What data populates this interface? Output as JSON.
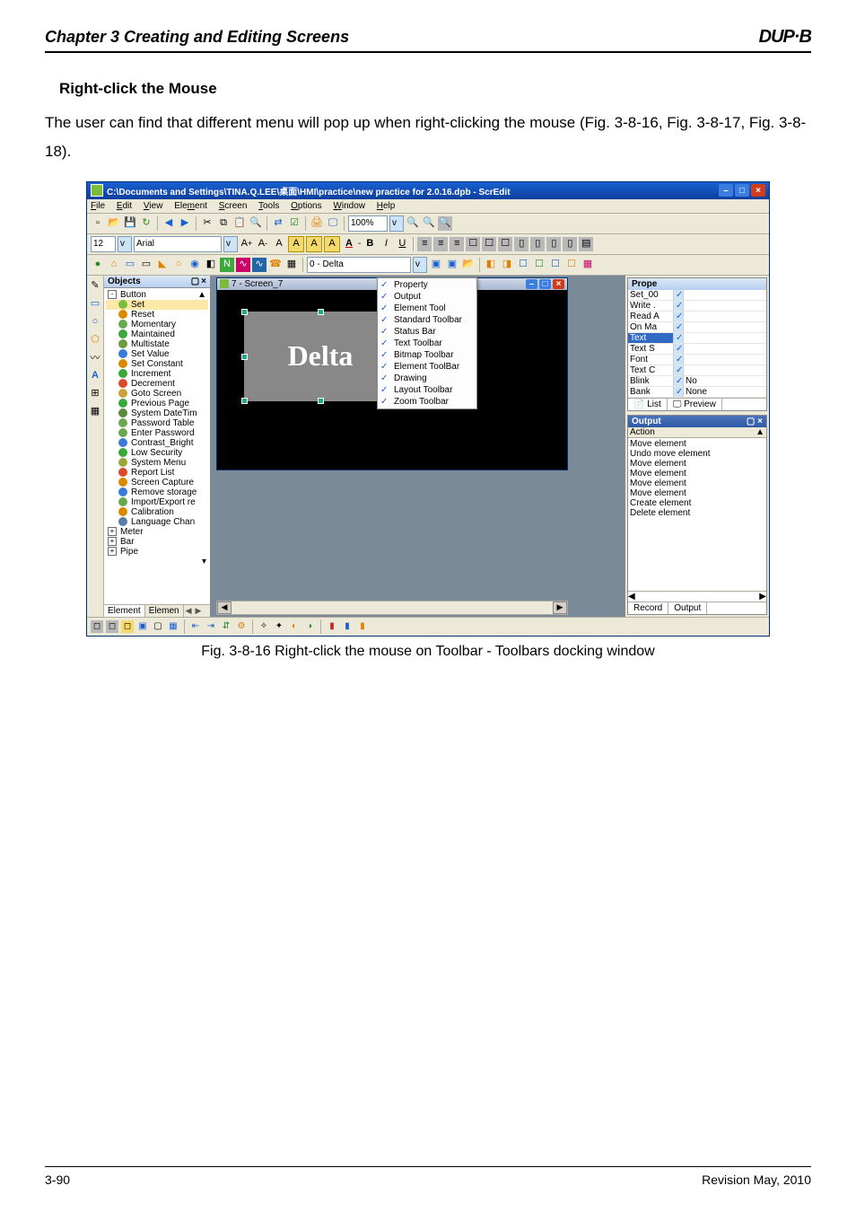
{
  "page": {
    "chapter_title": "Chapter 3 Creating and Editing Screens",
    "logo": "DUP·B",
    "section_title": "Right-click the Mouse",
    "body_text": "The user can find that different menu will pop up when right-clicking the mouse (Fig. 3-8-16, Fig. 3-8-17, Fig. 3-8-18).",
    "figure_caption": "Fig. 3-8-16 Right-click the mouse on Toolbar - Toolbars docking window",
    "footer_left": "3-90",
    "footer_right": "Revision May, 2010"
  },
  "window": {
    "title": "C:\\Documents and Settings\\TINA.Q.LEE\\桌面\\HMI\\practice\\new practice for 2.0.16.dpb - ScrEdit",
    "menus": [
      "File",
      "Edit",
      "View",
      "Element",
      "Screen",
      "Tools",
      "Options",
      "Window",
      "Help"
    ],
    "font_size": "12",
    "font_name": "Arial",
    "zoom_value": "100%",
    "screen_selector": "0 - Delta",
    "child_window_title": "7 - Screen_7",
    "canvas_text": "Delta"
  },
  "zoom_icons": [
    "🔍",
    "🔍",
    "🔍"
  ],
  "objects_panel": {
    "title": "Objects",
    "root": "Button",
    "items": [
      {
        "label": "Set",
        "color": "#7bbd3a",
        "sel": true
      },
      {
        "label": "Reset",
        "color": "#d98a00"
      },
      {
        "label": "Momentary",
        "color": "#6aa84f"
      },
      {
        "label": "Maintained",
        "color": "#3aa83a"
      },
      {
        "label": "Multistate",
        "color": "#6b9b3a"
      },
      {
        "label": "Set Value",
        "color": "#3a7ad9"
      },
      {
        "label": "Set Constant",
        "color": "#d98a00"
      },
      {
        "label": "Increment",
        "color": "#3aa83a"
      },
      {
        "label": "Decrement",
        "color": "#d94a2a"
      },
      {
        "label": "Goto Screen",
        "color": "#c9a23a"
      },
      {
        "label": "Previous Page",
        "color": "#3aa83a"
      },
      {
        "label": "System DateTim",
        "color": "#5a8a3a"
      },
      {
        "label": "Password Table",
        "color": "#6aa84f"
      },
      {
        "label": "Enter Password",
        "color": "#6aa84f"
      },
      {
        "label": "Contrast_Bright",
        "color": "#3a7ad9"
      },
      {
        "label": "Low Security",
        "color": "#3aa83a"
      },
      {
        "label": "System Menu",
        "color": "#9aa83a"
      },
      {
        "label": "Report List",
        "color": "#d94a2a"
      },
      {
        "label": "Screen Capture",
        "color": "#d98a00"
      },
      {
        "label": "Remove storage",
        "color": "#3a7ad9"
      },
      {
        "label": "Import/Export re",
        "color": "#6aa84f"
      },
      {
        "label": "Calibration",
        "color": "#d98a00"
      },
      {
        "label": "Language Chan",
        "color": "#5a7aa8"
      }
    ],
    "groups": [
      "Meter",
      "Bar",
      "Pipe"
    ],
    "tabs": [
      "Element",
      "Elemen"
    ]
  },
  "context_menu": {
    "items": [
      {
        "label": "Property",
        "checked": true
      },
      {
        "label": "Output",
        "checked": true
      },
      {
        "label": "Element Tool",
        "checked": true
      },
      {
        "label": "Standard Toolbar",
        "checked": true
      },
      {
        "label": "Status Bar",
        "checked": true
      },
      {
        "label": "Text Toolbar",
        "checked": true
      },
      {
        "label": "Bitmap Toolbar",
        "checked": true
      },
      {
        "label": "Element ToolBar",
        "checked": true
      },
      {
        "label": "Drawing",
        "checked": true
      },
      {
        "label": "Layout Toolbar",
        "checked": true
      },
      {
        "label": "Zoom Toolbar",
        "checked": true
      }
    ]
  },
  "property": {
    "header": "Prope",
    "rows": [
      {
        "k": "Set_00",
        "v": ""
      },
      {
        "k": "Write .",
        "v": ""
      },
      {
        "k": "Read A",
        "v": ""
      },
      {
        "k": "On Ma",
        "v": ""
      },
      {
        "k": "Text",
        "v": "",
        "hl": true
      },
      {
        "k": "Text S",
        "v": ""
      },
      {
        "k": "Font",
        "v": ""
      },
      {
        "k": "Text C",
        "v": ""
      },
      {
        "k": "Blink",
        "v": "No"
      },
      {
        "k": "Bank",
        "v": "None"
      }
    ],
    "footer": [
      "List",
      "Preview"
    ]
  },
  "output": {
    "header": "Output",
    "col": "Action",
    "rows": [
      "Move element",
      "Undo move element",
      "Move element",
      "Move element",
      "Move element",
      "Move element",
      "Create element",
      "Delete element"
    ],
    "tabs": [
      "Record",
      "Output"
    ]
  }
}
